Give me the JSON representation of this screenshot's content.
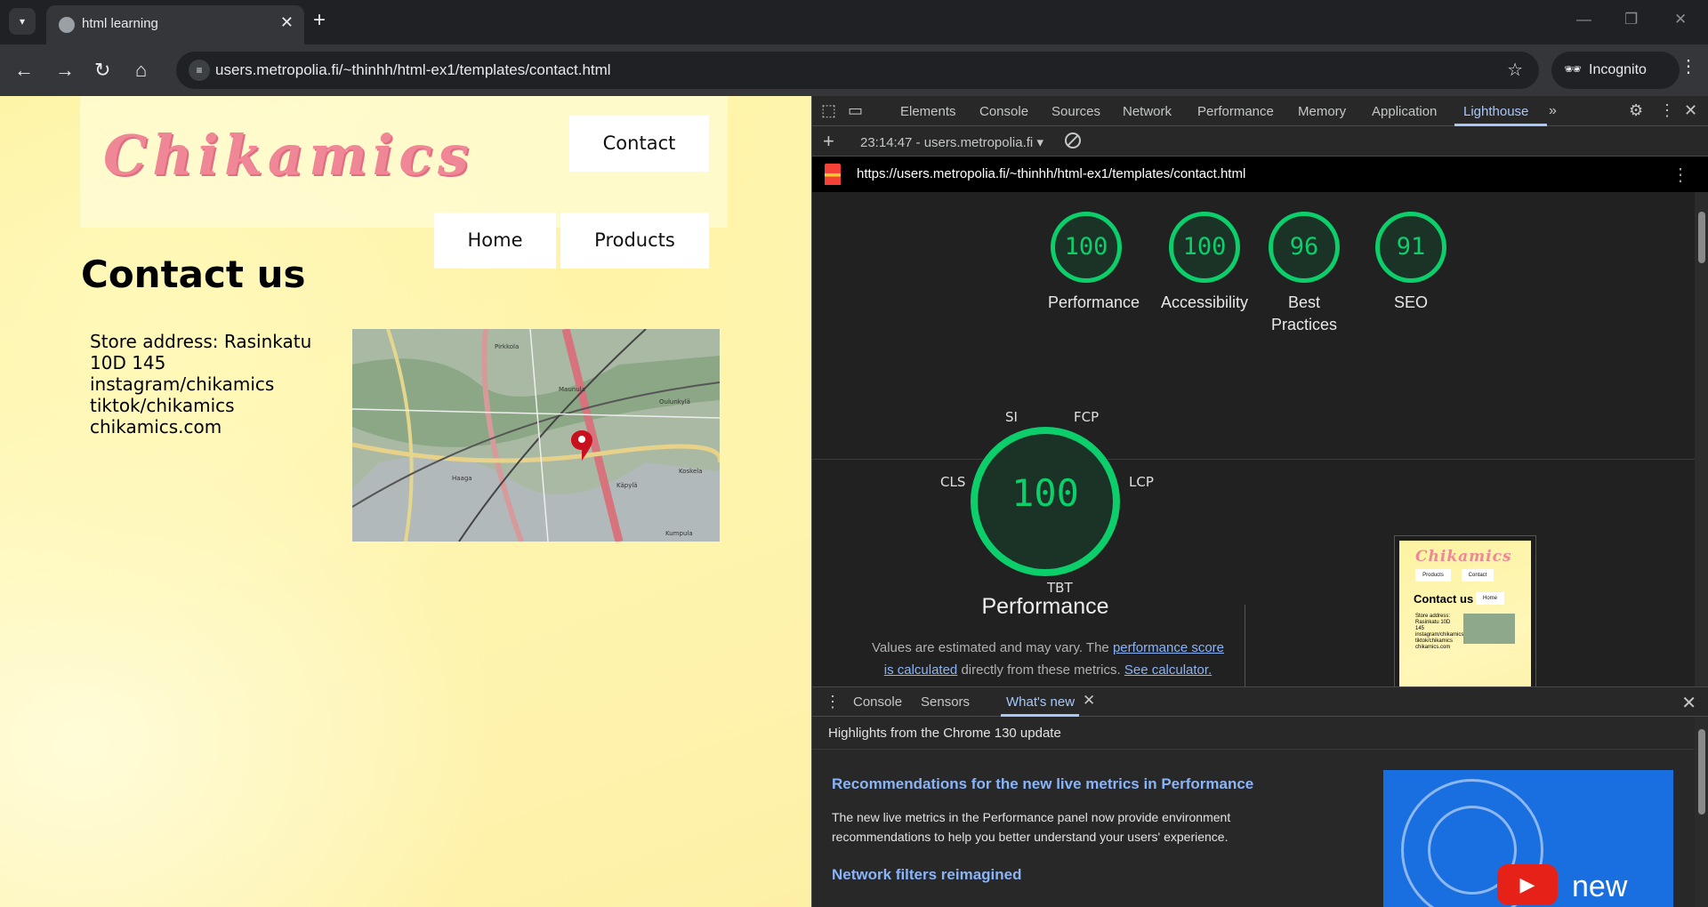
{
  "browser": {
    "tab_title": "html learning",
    "url": "users.metropolia.fi/~thinhh/html-ex1/templates/contact.html",
    "incognito_label": "Incognito"
  },
  "page": {
    "logo_text": "Chikamics",
    "nav": {
      "contact": "Contact",
      "home": "Home",
      "products": "Products"
    },
    "heading": "Contact us",
    "address_lines": [
      "Store address: Rasinkatu",
      "10D 145",
      "instagram/chikamics",
      "tiktok/chikamics",
      "chikamics.com"
    ],
    "map_labels": [
      "Pirkkola",
      "Maunula",
      "Oulunkylä",
      "Haaga",
      "Käpylä",
      "Koskela",
      "Kumpula"
    ]
  },
  "devtools": {
    "tabs": [
      "Elements",
      "Console",
      "Sources",
      "Network",
      "Performance",
      "Memory",
      "Application",
      "Lighthouse"
    ],
    "active_tab": "Lighthouse",
    "run_label": "23:14:47 - users.metropolia.fi",
    "report_url": "https://users.metropolia.fi/~thinhh/html-ex1/templates/contact.html",
    "scores": [
      {
        "label": "Performance",
        "value": "100"
      },
      {
        "label": "Accessibility",
        "value": "100"
      },
      {
        "label": "Best Practices",
        "value": "96"
      },
      {
        "label": "SEO",
        "value": "91"
      }
    ],
    "metric_labels": {
      "si": "SI",
      "fcp": "FCP",
      "cls": "CLS",
      "lcp": "LCP",
      "tbt": "TBT"
    },
    "perf_score": "100",
    "perf_title": "Performance",
    "note_text": "Values are estimated and may vary. The",
    "note_link1": "performance score is calculated",
    "note_mid": "directly from these metrics.",
    "note_link2": "See calculator.",
    "thumb": {
      "logo": "Chikamics",
      "products": "Products",
      "contact": "Contact",
      "home": "Home",
      "title": "Contact us",
      "address": "Store address: Rasinkatu 10D 145 instagram/chikamics tiktok/chikamics chikamics.com"
    },
    "drawer": {
      "tabs": [
        "Console",
        "Sensors",
        "What's new"
      ],
      "active_tab": "What's new",
      "highlights": "Highlights from the Chrome 130 update",
      "h1": "Recommendations for the new live metrics in Performance",
      "p1": "The new live metrics in the Performance panel now provide environment recommendations to help you better understand your users' experience.",
      "h2": "Network filters reimagined",
      "video_text": "new"
    }
  },
  "colors": {
    "score_green": "#0cce6b",
    "link_blue": "#8ab4f8",
    "logo_pink": "#f08796"
  }
}
